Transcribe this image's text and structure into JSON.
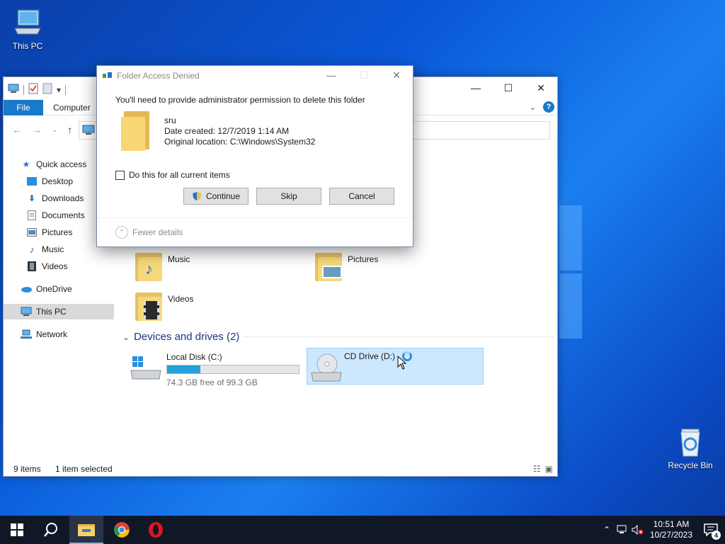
{
  "desktop": {
    "icons": [
      {
        "label": "This PC",
        "icon": "computer-icon"
      },
      {
        "label": "Recycle Bin",
        "icon": "recycle-bin-icon"
      }
    ]
  },
  "explorer": {
    "ribbon": {
      "file_tab": "File",
      "computer_tab": "Computer"
    },
    "sidebar": [
      {
        "label": "Quick access",
        "icon": "star-icon"
      },
      {
        "label": "Desktop",
        "icon": "desktop-folder-icon"
      },
      {
        "label": "Downloads",
        "icon": "download-arrow-icon"
      },
      {
        "label": "Documents",
        "icon": "document-icon"
      },
      {
        "label": "Pictures",
        "icon": "picture-icon"
      },
      {
        "label": "Music",
        "icon": "music-note-icon"
      },
      {
        "label": "Videos",
        "icon": "film-icon"
      },
      {
        "label": "OneDrive",
        "icon": "cloud-icon"
      },
      {
        "label": "This PC",
        "icon": "computer-icon",
        "selected": true
      },
      {
        "label": "Network",
        "icon": "network-icon"
      }
    ],
    "folders": [
      {
        "label": "Music",
        "icon": "music-note-icon"
      },
      {
        "label": "Pictures",
        "icon": "picture-icon"
      },
      {
        "label": "Videos",
        "icon": "film-icon"
      }
    ],
    "devices_header": "Devices and drives (2)",
    "drives": [
      {
        "name": "Local Disk (C:)",
        "free": "74.3 GB free of 99.3 GB",
        "used_fraction": 0.252
      },
      {
        "name": "CD Drive (D:)"
      }
    ],
    "status": {
      "item_count": "9 items",
      "selection": "1 item selected"
    }
  },
  "dialog": {
    "title": "Folder Access Denied",
    "message": "You'll need to provide administrator permission to delete this folder",
    "folder_name": "sru",
    "date_created": "Date created: 12/7/2019 1:14 AM",
    "original_location": "Original location: C:\\Windows\\System32",
    "checkbox_label": "Do this for all current items",
    "buttons": {
      "continue": "Continue",
      "skip": "Skip",
      "cancel": "Cancel"
    },
    "fewer_details": "Fewer details"
  },
  "taskbar": {
    "apps": [
      "start-icon",
      "search-icon",
      "file-explorer-icon",
      "chrome-icon",
      "opera-icon"
    ],
    "time": "10:51 AM",
    "date": "10/27/2023",
    "notification_count": "4"
  }
}
